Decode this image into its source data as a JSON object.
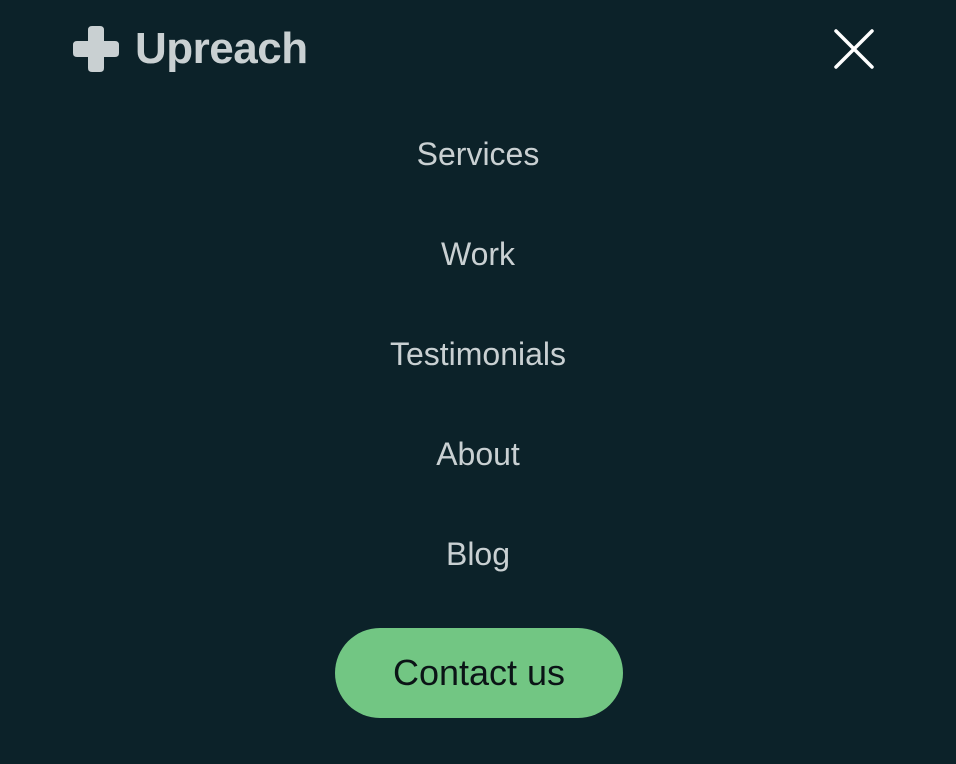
{
  "colors": {
    "background": "#0c2229",
    "text": "#c9d0d2",
    "accent": "#72c683",
    "button_text": "#0b1416",
    "close_icon": "#ffffff"
  },
  "header": {
    "logo_icon": "plus-logo-icon",
    "brand": "Upreach",
    "close_icon": "close-icon"
  },
  "nav": {
    "items": [
      {
        "label": "Services"
      },
      {
        "label": "Work"
      },
      {
        "label": "Testimonials"
      },
      {
        "label": "About"
      },
      {
        "label": "Blog"
      }
    ]
  },
  "cta": {
    "label": "Contact us"
  }
}
